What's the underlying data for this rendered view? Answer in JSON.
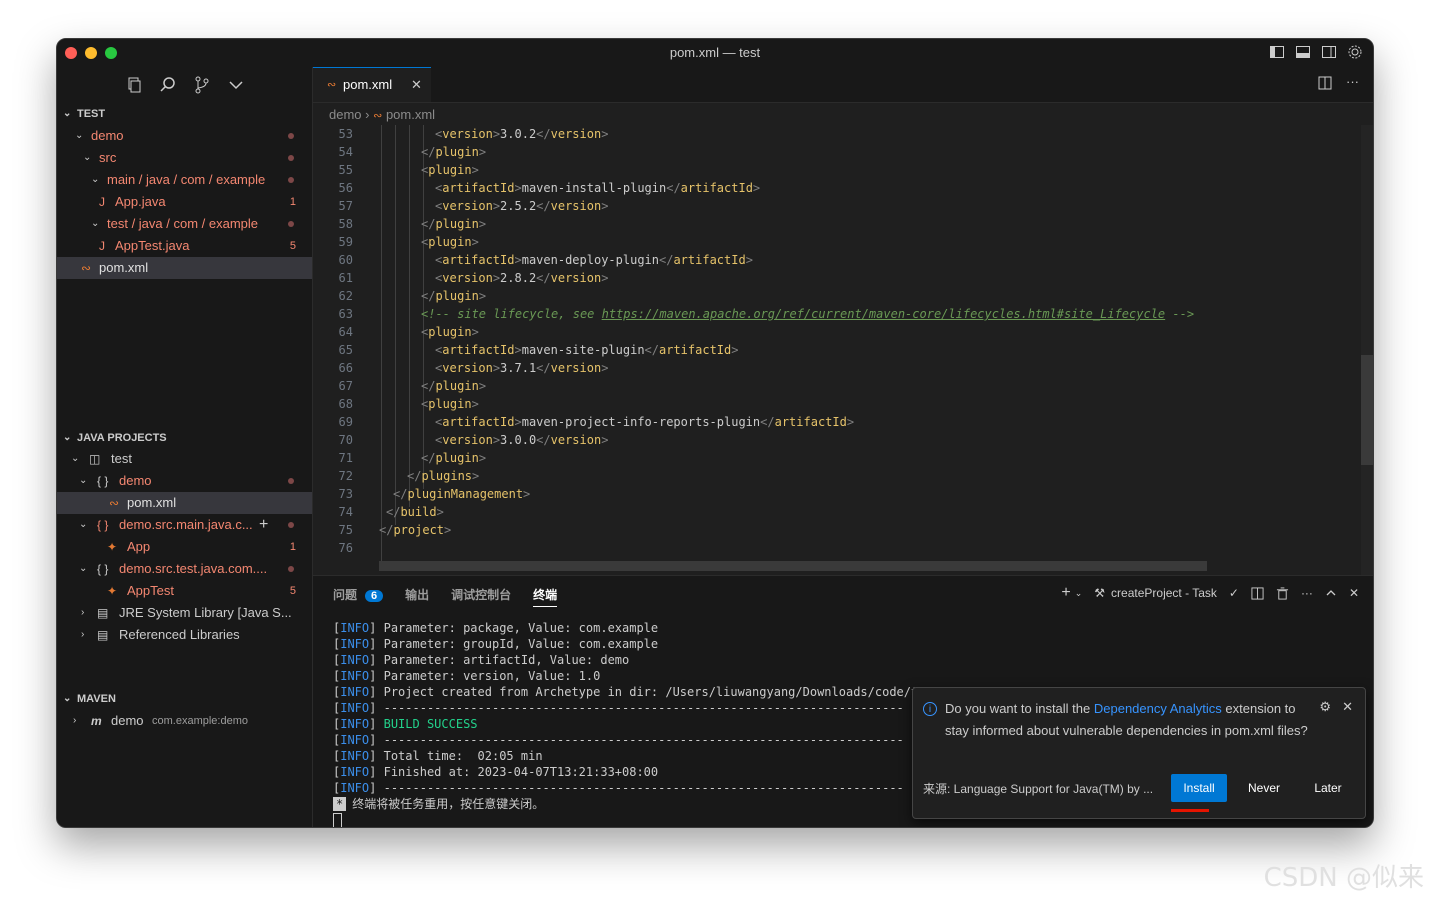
{
  "window": {
    "title": "pom.xml — test"
  },
  "sidebar": {
    "sections": {
      "test": "TEST",
      "java_projects": "JAVA PROJECTS",
      "maven": "MAVEN"
    },
    "explorer": [
      {
        "label": "demo"
      },
      {
        "label": "src"
      },
      {
        "label": "main / java / com / example"
      },
      {
        "label": "App.java",
        "badge": "1"
      },
      {
        "label": "test / java / com / example"
      },
      {
        "label": "AppTest.java",
        "badge": "5"
      },
      {
        "label": "pom.xml"
      }
    ],
    "projects": [
      {
        "label": "test"
      },
      {
        "label": "demo"
      },
      {
        "label": "pom.xml"
      },
      {
        "label": "demo.src.main.java.c..."
      },
      {
        "label": "App",
        "badge": "1"
      },
      {
        "label": "demo.src.test.java.com...."
      },
      {
        "label": "AppTest",
        "badge": "5"
      },
      {
        "label": "JRE System Library [Java S..."
      },
      {
        "label": "Referenced Libraries"
      }
    ],
    "maven": {
      "label": "demo",
      "detail": "com.example:demo"
    }
  },
  "editor": {
    "tab": "pom.xml",
    "breadcrumb": [
      "demo",
      "pom.xml"
    ],
    "lines": [
      {
        "n": "53",
        "indent": 4,
        "kind": "el",
        "tag": "version",
        "value": "3.0.2"
      },
      {
        "n": "54",
        "indent": 3,
        "kind": "close",
        "tag": "plugin"
      },
      {
        "n": "55",
        "indent": 3,
        "kind": "open",
        "tag": "plugin"
      },
      {
        "n": "56",
        "indent": 4,
        "kind": "el",
        "tag": "artifactId",
        "value": "maven-install-plugin"
      },
      {
        "n": "57",
        "indent": 4,
        "kind": "el",
        "tag": "version",
        "value": "2.5.2"
      },
      {
        "n": "58",
        "indent": 3,
        "kind": "close",
        "tag": "plugin"
      },
      {
        "n": "59",
        "indent": 3,
        "kind": "open",
        "tag": "plugin"
      },
      {
        "n": "60",
        "indent": 4,
        "kind": "el",
        "tag": "artifactId",
        "value": "maven-deploy-plugin"
      },
      {
        "n": "61",
        "indent": 4,
        "kind": "el",
        "tag": "version",
        "value": "2.8.2"
      },
      {
        "n": "62",
        "indent": 3,
        "kind": "close",
        "tag": "plugin"
      },
      {
        "n": "63",
        "indent": 3,
        "kind": "comment",
        "pre": "<!-- site lifecycle, see ",
        "url": "https://maven.apache.org/ref/current/maven-core/lifecycles.html#site_Lifecycle",
        "post": " -->"
      },
      {
        "n": "64",
        "indent": 3,
        "kind": "open",
        "tag": "plugin"
      },
      {
        "n": "65",
        "indent": 4,
        "kind": "el",
        "tag": "artifactId",
        "value": "maven-site-plugin"
      },
      {
        "n": "66",
        "indent": 4,
        "kind": "el",
        "tag": "version",
        "value": "3.7.1"
      },
      {
        "n": "67",
        "indent": 3,
        "kind": "close",
        "tag": "plugin"
      },
      {
        "n": "68",
        "indent": 3,
        "kind": "open",
        "tag": "plugin"
      },
      {
        "n": "69",
        "indent": 4,
        "kind": "el",
        "tag": "artifactId",
        "value": "maven-project-info-reports-plugin"
      },
      {
        "n": "70",
        "indent": 4,
        "kind": "el",
        "tag": "version",
        "value": "3.0.0"
      },
      {
        "n": "71",
        "indent": 3,
        "kind": "close",
        "tag": "plugin"
      },
      {
        "n": "72",
        "indent": 2,
        "kind": "close",
        "tag": "plugins"
      },
      {
        "n": "73",
        "indent": 1,
        "kind": "close",
        "tag": "pluginManagement"
      },
      {
        "n": "74",
        "indent": 0.5,
        "kind": "close",
        "tag": "build"
      },
      {
        "n": "75",
        "indent": 0,
        "kind": "close",
        "tag": "project"
      },
      {
        "n": "76",
        "indent": 0,
        "kind": "empty"
      }
    ]
  },
  "panel": {
    "tabs": [
      "问题",
      "输出",
      "调试控制台",
      "终端"
    ],
    "problems_count": "6",
    "task_label": "createProject - Task",
    "terminal": [
      {
        "tag": "INFO",
        "text": " Parameter: package, Value: com.example"
      },
      {
        "tag": "INFO",
        "text": " Parameter: groupId, Value: com.example"
      },
      {
        "tag": "INFO",
        "text": " Parameter: artifactId, Value: demo"
      },
      {
        "tag": "INFO",
        "text": " Parameter: version, Value: 1.0"
      },
      {
        "tag": "INFO",
        "text": " Project created from Archetype in dir: /Users/liuwangyang/Downloads/code/tes"
      },
      {
        "tag": "INFO",
        "text": " ------------------------------------------------------------------------"
      },
      {
        "tag": "INFO",
        "text": " BUILD SUCCESS",
        "success": true
      },
      {
        "tag": "INFO",
        "text": " ------------------------------------------------------------------------"
      },
      {
        "tag": "INFO",
        "text": " Total time:  02:05 min"
      },
      {
        "tag": "INFO",
        "text": " Finished at: 2023-04-07T13:21:33+08:00"
      },
      {
        "tag": "INFO",
        "text": " ------------------------------------------------------------------------"
      }
    ],
    "terminal_note": "终端将被任务重用，按任意键关闭。"
  },
  "notification": {
    "pre": "Do you want to install the ",
    "link": "Dependency Analytics",
    "post": " extension to stay informed about vulnerable dependencies in pom.xml files?",
    "source": "来源: Language Support for Java(TM) by ...",
    "install": "Install",
    "never": "Never",
    "later": "Later"
  },
  "watermark": "CSDN @似来",
  "colors": {
    "accent": "#0078d4",
    "error": "#f48771",
    "install_underline": "#e51400"
  }
}
